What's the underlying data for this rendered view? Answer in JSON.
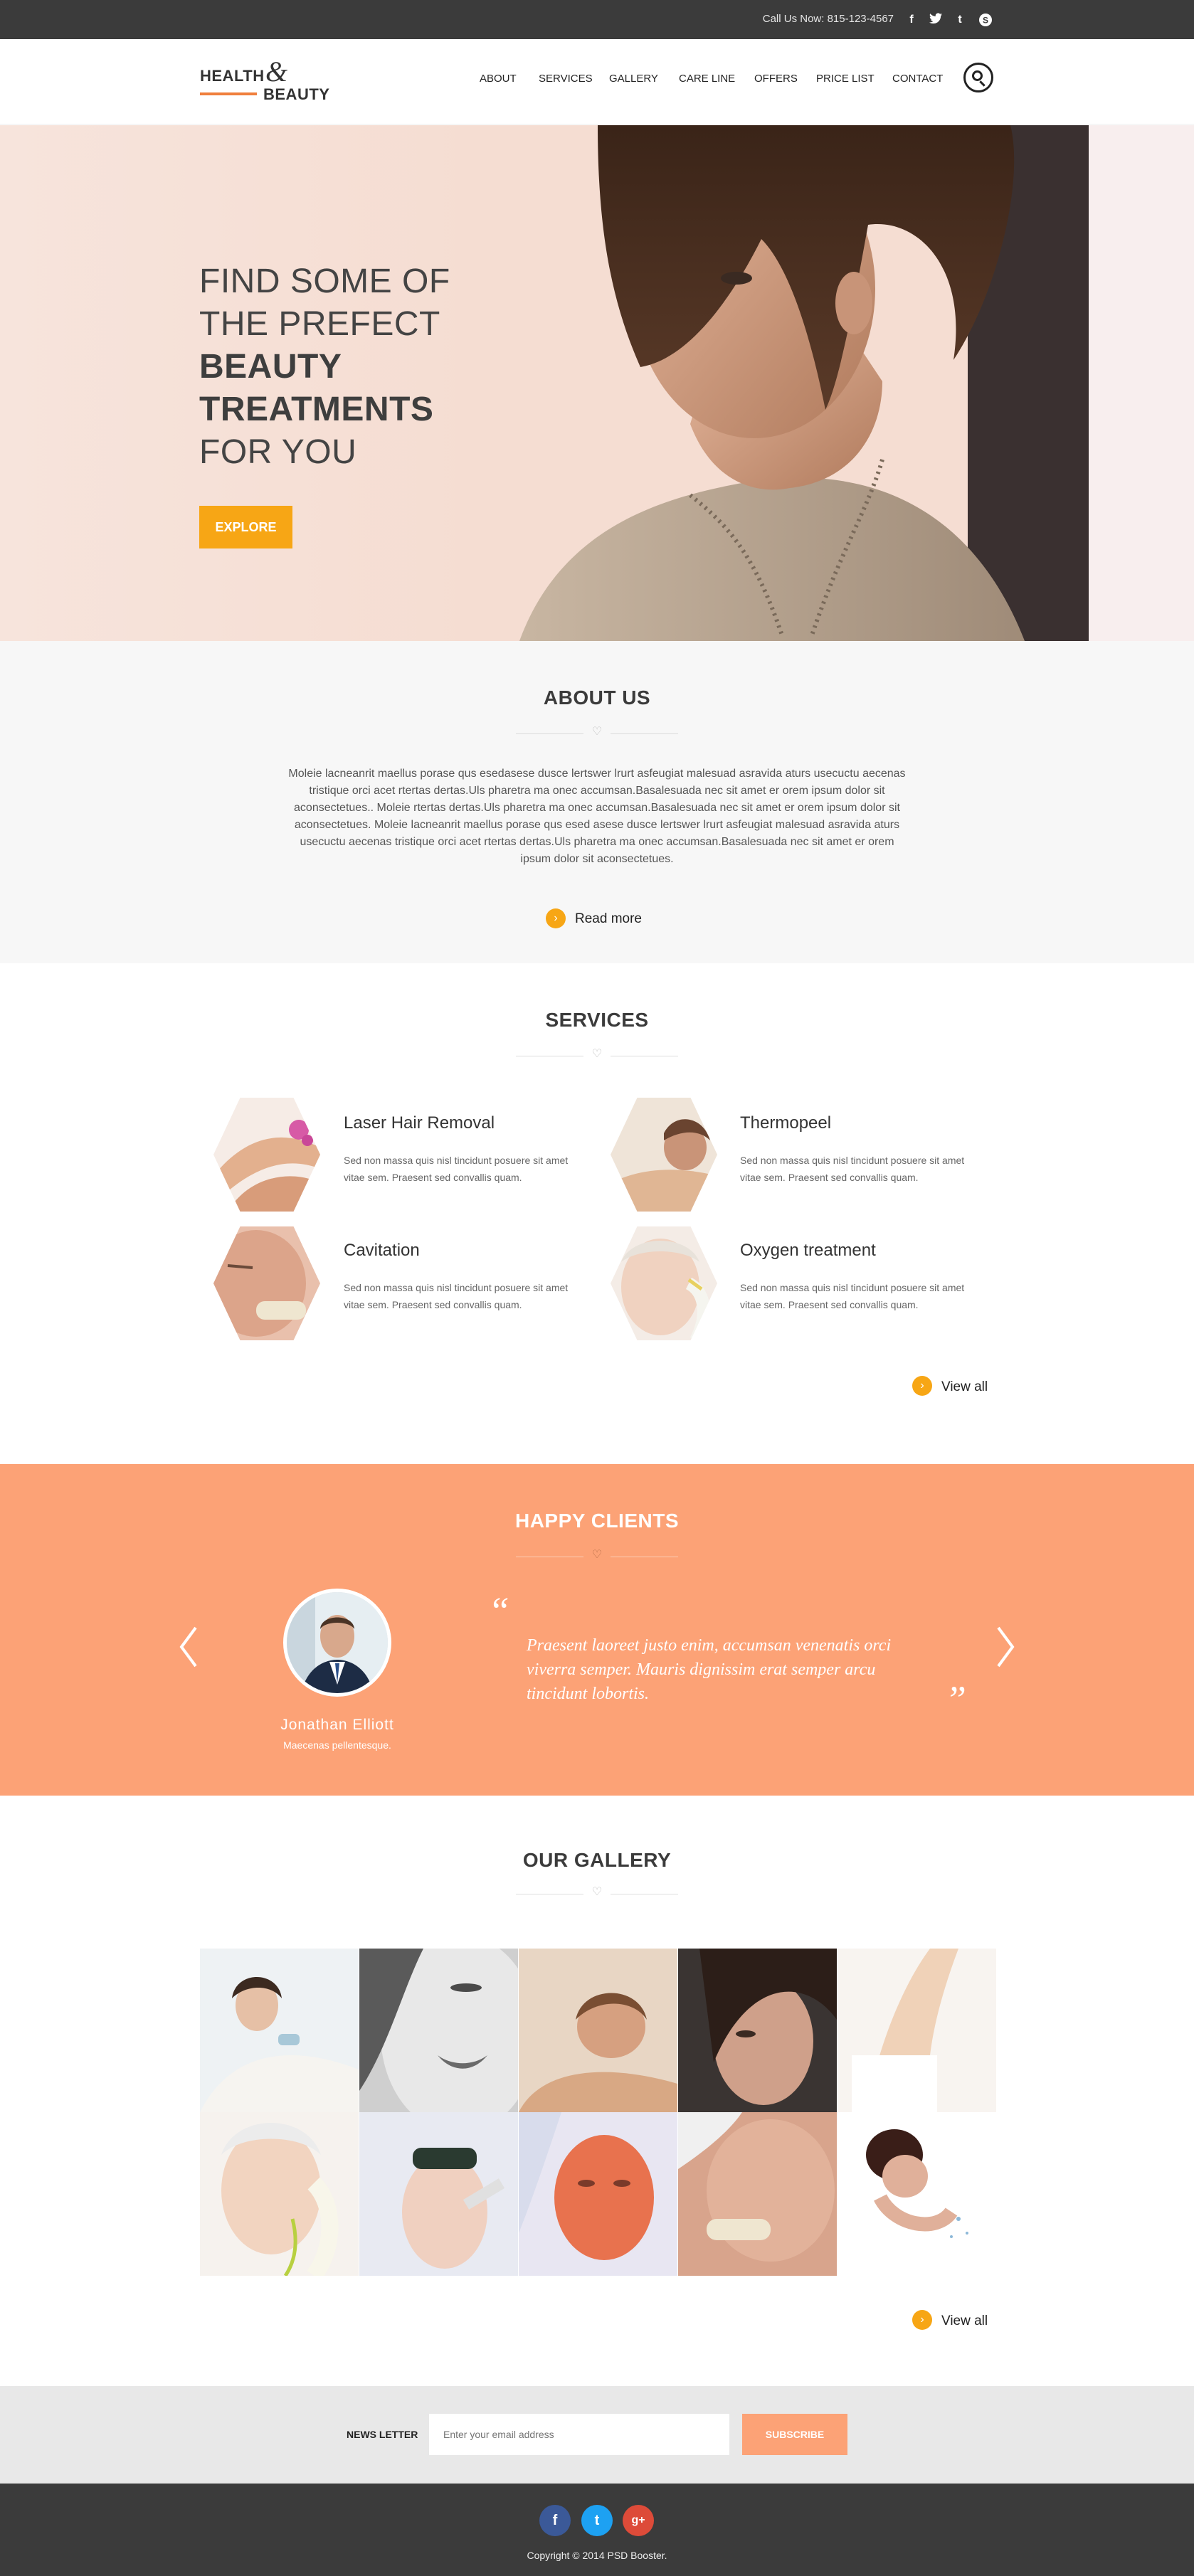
{
  "topbar": {
    "call": "Call Us Now: 815-123-4567",
    "social": [
      "facebook-icon",
      "twitter-icon",
      "tumblr-icon",
      "skype-icon"
    ]
  },
  "logo": {
    "health": "HEALTH",
    "amp": "&",
    "beauty": "BEAUTY"
  },
  "nav": [
    "ABOUT",
    "SERVICES",
    "GALLERY",
    "CARE LINE",
    "OFFERS",
    "PRICE LIST",
    "CONTACT"
  ],
  "hero": {
    "line1": "FIND SOME OF",
    "line2": "THE PREFECT",
    "line3": "BEAUTY",
    "line4": "TREATMENTS",
    "line5": "FOR YOU",
    "button": "EXPLORE"
  },
  "about": {
    "title": "ABOUT US",
    "text": "Moleie lacneanrit maellus porase qus esedasese dusce lertswer lrurt asfeugiat malesuad asravida aturs usecuctu aecenas tristique orci acet rtertas dertas.Uls pharetra ma onec accumsan.Basalesuada nec sit amet er orem ipsum dolor sit aconsectetues.. Moleie rtertas dertas.Uls pharetra ma onec accumsan.Basalesuada nec sit amet er orem ipsum dolor sit aconsectetues. Moleie lacneanrit maellus porase qus esed asese dusce lertswer lrurt asfeugiat malesuad asravida aturs usecuctu aecenas tristique orci acet rtertas dertas.Uls pharetra ma onec accumsan.Basalesuada nec sit amet er orem ipsum dolor sit aconsectetues.",
    "read_more": "Read more"
  },
  "services": {
    "title": "SERVICES",
    "items": [
      {
        "title": "Laser Hair Removal",
        "desc": "Sed non massa quis nisl tincidunt posuere sit amet vitae sem. Praesent sed convallis quam."
      },
      {
        "title": "Thermopeel",
        "desc": "Sed non massa quis nisl tincidunt posuere sit amet vitae sem. Praesent sed convallis quam."
      },
      {
        "title": "Cavitation",
        "desc": "Sed non massa quis nisl tincidunt posuere sit amet vitae sem. Praesent sed convallis quam."
      },
      {
        "title": "Oxygen treatment",
        "desc": "Sed non massa quis nisl tincidunt posuere sit amet vitae sem. Praesent sed convallis quam."
      }
    ],
    "view_all": "View all"
  },
  "clients": {
    "title": "HAPPY CLIENTS",
    "name": "Jonathan Elliott",
    "role": "Maecenas pellentesque.",
    "open_quote": "“",
    "close_quote": "”",
    "quote": "Praesent laoreet justo enim, accumsan venenatis orci viverra semper. Mauris dignissim erat semper arcu tincidunt lobortis."
  },
  "gallery": {
    "title": "OUR GALLERY",
    "view_all": "View all"
  },
  "newsletter": {
    "label": "NEWS LETTER",
    "placeholder": "Enter your email address",
    "button": "SUBSCRIBE"
  },
  "footer": {
    "social": [
      "f",
      "t",
      "g+"
    ],
    "copyright": "Copyright © 2014 PSD Booster."
  },
  "colors": {
    "accent": "#f7a615",
    "peach": "#fca276",
    "dark": "#3b3b3b",
    "logo_line": "#f07f3c"
  }
}
